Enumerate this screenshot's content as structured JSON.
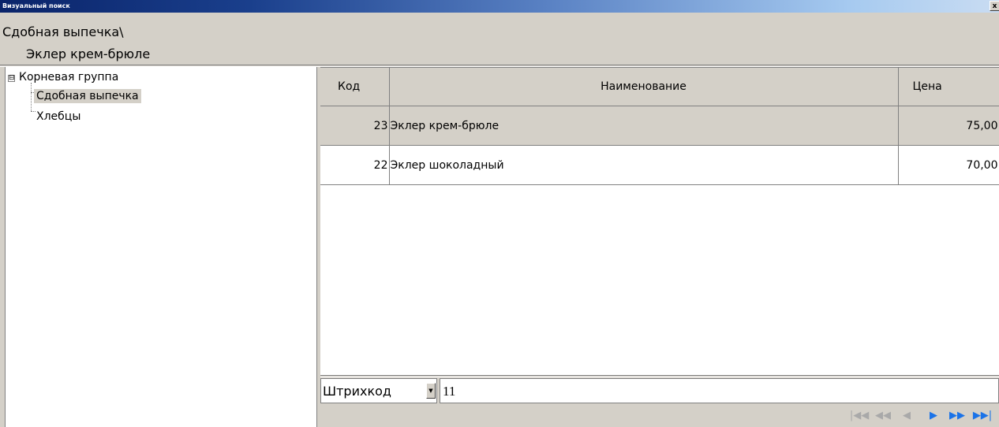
{
  "window": {
    "title": "Визуальный поиск",
    "close_glyph": "x"
  },
  "header": {
    "path": "Сдобная выпечка\\",
    "selected_product": "Эклер крем-брюле"
  },
  "tree": {
    "expander_glyph": "⊟",
    "root_label": "Корневая группа",
    "children": [
      "Сдобная выпечка",
      "Хлебцы"
    ],
    "selected_child": "Сдобная выпечка"
  },
  "grid": {
    "columns": {
      "code": "Код",
      "name": "Наименование",
      "price": "Цена"
    },
    "rows": [
      {
        "code": "23",
        "name": "Эклер крем-брюле",
        "price": "75,00",
        "selected": true
      },
      {
        "code": "22",
        "name": "Эклер шоколадный",
        "price": "70,00",
        "selected": false
      }
    ]
  },
  "search": {
    "field_selected": "Штрихкод",
    "value": "11"
  },
  "nav_icons": [
    "first-icon",
    "prev-page-icon",
    "prev-icon",
    "next-icon",
    "next-page-icon",
    "last-icon"
  ],
  "colors": {
    "title_start": "#0a246a",
    "title_end": "#a6caf0",
    "window_bg": "#d4d0c8",
    "nav_enabled": "#1a73e8",
    "nav_disabled": "#a9a9a9"
  }
}
